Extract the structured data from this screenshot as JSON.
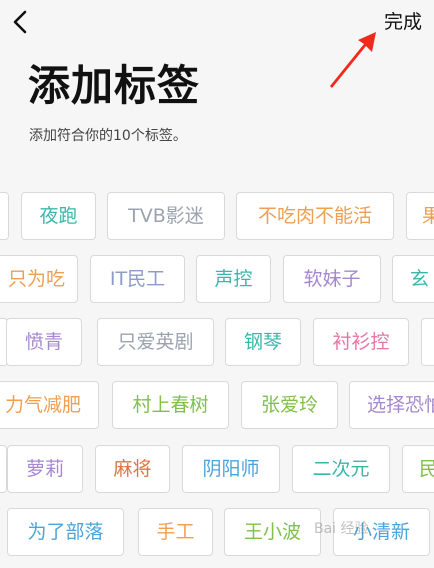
{
  "header": {
    "done_label": "完成",
    "title": "添加标签",
    "subtitle": "添加符合你的10个标签。"
  },
  "tags": [
    {
      "label": "夜跑",
      "color": "#3cb6ab"
    },
    {
      "label": "TVB影迷",
      "color": "#9aa3b0"
    },
    {
      "label": "不吃肉不能活",
      "color": "#eea052"
    },
    {
      "label": "只为吃",
      "color": "#eea052"
    },
    {
      "label": "IT民工",
      "color": "#8c9cc9"
    },
    {
      "label": "声控",
      "color": "#3cb6ab"
    },
    {
      "label": "软妹子",
      "color": "#a587d0"
    },
    {
      "label": "愤青",
      "color": "#a587d0"
    },
    {
      "label": "只爱英剧",
      "color": "#9aa3b0"
    },
    {
      "label": "钢琴",
      "color": "#3cb6ab"
    },
    {
      "label": "衬衫控",
      "color": "#e675a2"
    },
    {
      "label": "力气减肥",
      "color": "#eea052"
    },
    {
      "label": "村上春树",
      "color": "#7fc14a"
    },
    {
      "label": "张爱玲",
      "color": "#7fc14a"
    },
    {
      "label": "选择恐怕",
      "color": "#a587d0"
    },
    {
      "label": "萝莉",
      "color": "#a587d0"
    },
    {
      "label": "麻将",
      "color": "#e0734a"
    },
    {
      "label": "阴阳师",
      "color": "#4aa4d8"
    },
    {
      "label": "二次元",
      "color": "#3cb6ab"
    },
    {
      "label": "为了部落",
      "color": "#4aa4d8"
    },
    {
      "label": "手工",
      "color": "#eea052"
    },
    {
      "label": "王小波",
      "color": "#7fc14a"
    },
    {
      "label": "小清新",
      "color": "#4aa4d8"
    }
  ]
}
